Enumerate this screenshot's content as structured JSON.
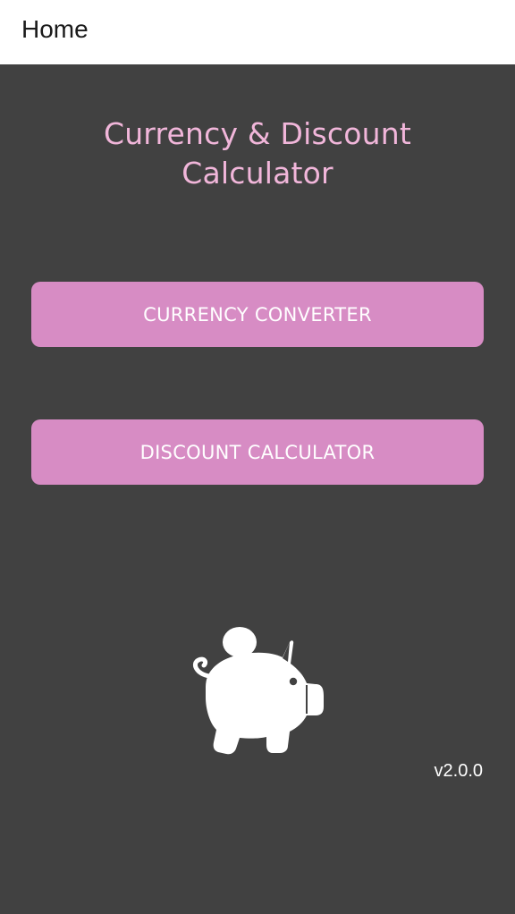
{
  "app_bar": {
    "title": "Home"
  },
  "main": {
    "heading_line1": "Currency & Discount",
    "heading_line2": "Calculator",
    "buttons": {
      "currency_converter": "CURRENCY CONVERTER",
      "discount_calculator": "DISCOUNT CALCULATOR"
    },
    "illustration": "piggy-bank-icon",
    "version": "v2.0.0"
  },
  "colors": {
    "background": "#414141",
    "app_bar": "#ffffff",
    "heading": "#f1b6da",
    "button": "#d78cc4",
    "button_text": "#ffffff"
  }
}
